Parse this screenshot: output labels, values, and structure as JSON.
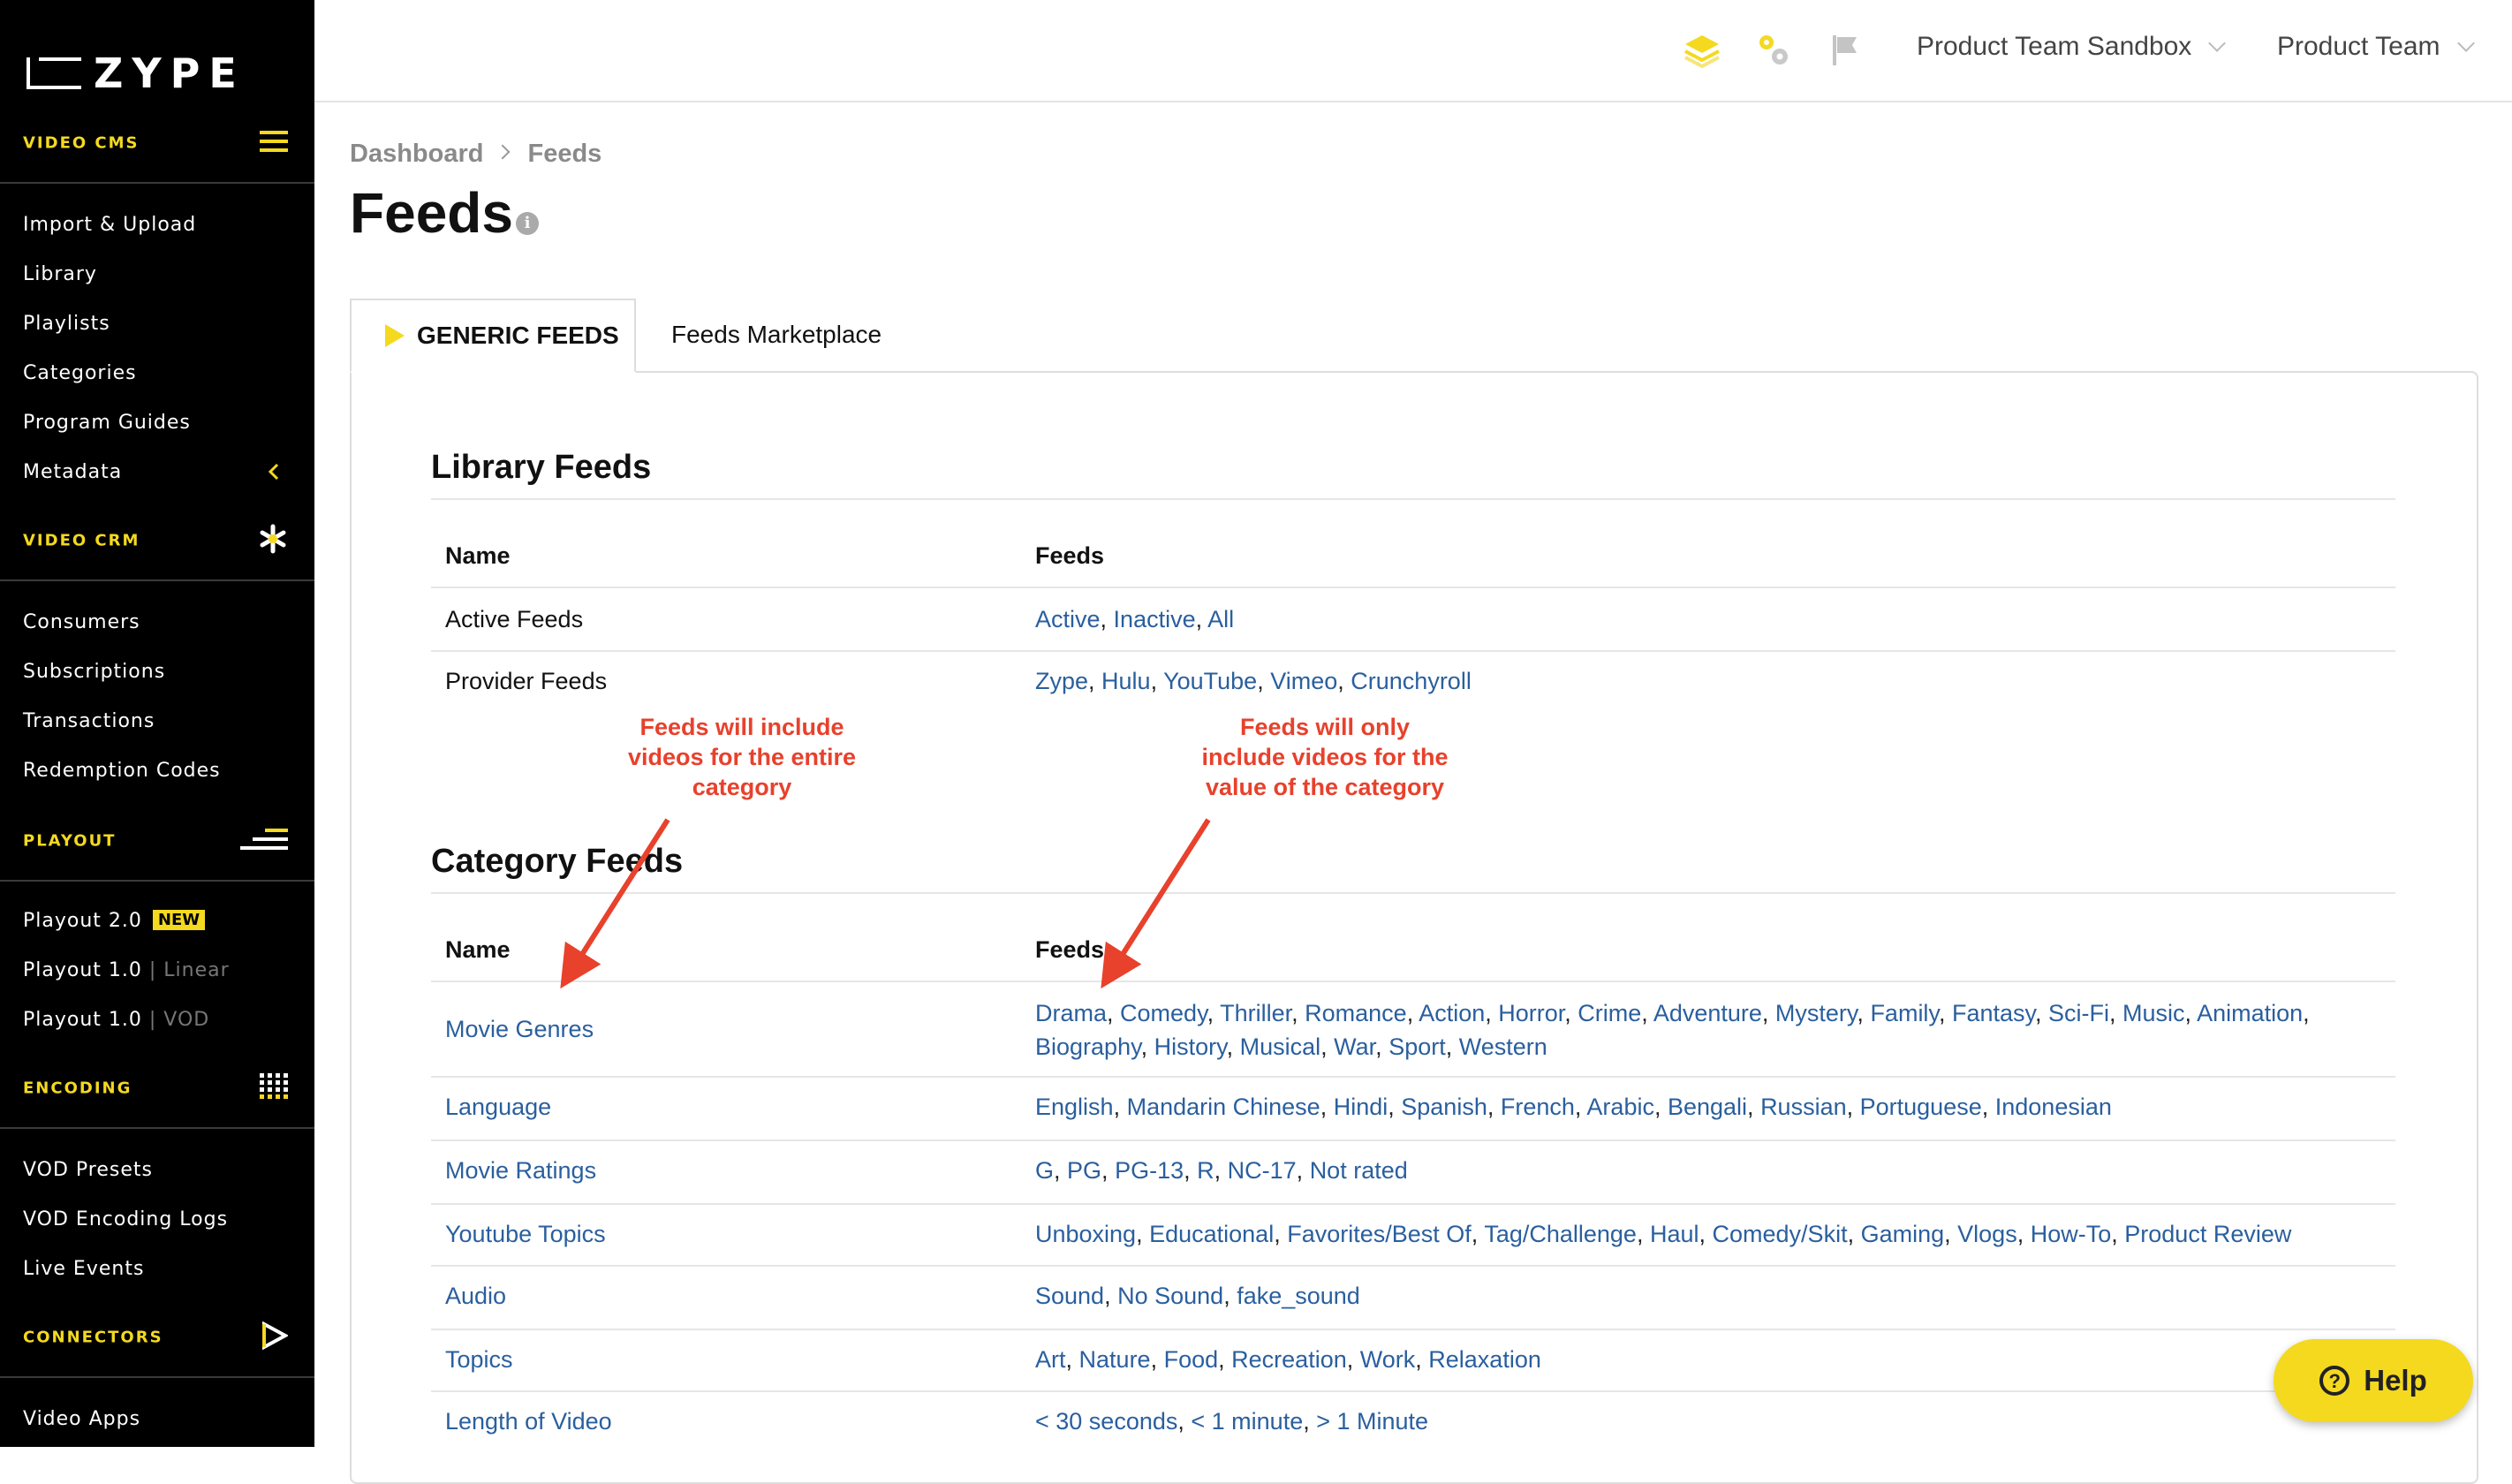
{
  "sidebar": {
    "logo": "ZYPE",
    "sections": [
      {
        "label": "VIDEO CMS",
        "icon": "hamburger-icon",
        "items": [
          "Import & Upload",
          "Library",
          "Playlists",
          "Categories",
          "Program Guides",
          "Metadata"
        ]
      },
      {
        "label": "VIDEO CRM",
        "icon": "asterisk-icon",
        "items": [
          "Consumers",
          "Subscriptions",
          "Transactions",
          "Redemption Codes"
        ]
      },
      {
        "label": "PLAYOUT",
        "icon": "stairs-icon",
        "items": [
          {
            "label": "Playout 2.0",
            "badge": "NEW"
          },
          {
            "label": "Playout 1.0",
            "sub": "Linear"
          },
          {
            "label": "Playout 1.0",
            "sub": "VOD"
          }
        ]
      },
      {
        "label": "ENCODING",
        "icon": "grid-dots-icon",
        "items": [
          "VOD Presets",
          "VOD Encoding Logs",
          "Live Events"
        ]
      },
      {
        "label": "CONNECTORS",
        "icon": "play-icon",
        "items": [
          "Video Apps"
        ]
      }
    ]
  },
  "topbar": {
    "icons": [
      "layers-icon",
      "gears-icon",
      "flag-icon"
    ],
    "workspace": "Product Team Sandbox",
    "account": "Product Team"
  },
  "breadcrumb": {
    "home": "Dashboard",
    "separator": ">",
    "current": "Feeds"
  },
  "page": {
    "title": "Feeds",
    "info": "i"
  },
  "tabs": {
    "active": "GENERIC FEEDS",
    "inactive": "Feeds Marketplace"
  },
  "library_feeds": {
    "title": "Library Feeds",
    "headers": {
      "name": "Name",
      "feeds": "Feeds"
    },
    "rows": [
      {
        "name": "Active Feeds",
        "feeds": [
          "Active",
          "Inactive",
          "All"
        ]
      },
      {
        "name": "Provider Feeds",
        "feeds": [
          "Zype",
          "Hulu",
          "YouTube",
          "Vimeo",
          "Crunchyroll"
        ]
      }
    ]
  },
  "category_feeds": {
    "title": "Category Feeds",
    "headers": {
      "name": "Name",
      "feeds": "Feeds"
    },
    "rows": [
      {
        "name": "Movie Genres",
        "feeds": [
          "Drama",
          "Comedy",
          "Thriller",
          "Romance",
          "Action",
          "Horror",
          "Crime",
          "Adventure",
          "Mystery",
          "Family",
          "Fantasy",
          "Sci-Fi",
          "Music",
          "Animation",
          "Biography",
          "History",
          "Musical",
          "War",
          "Sport",
          "Western"
        ]
      },
      {
        "name": "Language",
        "feeds": [
          "English",
          "Mandarin Chinese",
          "Hindi",
          "Spanish",
          "French",
          "Arabic",
          "Bengali",
          "Russian",
          "Portuguese",
          "Indonesian"
        ]
      },
      {
        "name": "Movie Ratings",
        "feeds": [
          "G",
          "PG",
          "PG-13",
          "R",
          "NC-17",
          "Not rated"
        ]
      },
      {
        "name": "Youtube Topics",
        "feeds": [
          "Unboxing",
          "Educational",
          "Favorites/Best Of",
          "Tag/Challenge",
          "Haul",
          "Comedy/Skit",
          "Gaming",
          "Vlogs",
          "How-To",
          "Product Review"
        ]
      },
      {
        "name": "Audio",
        "feeds": [
          "Sound",
          "No Sound",
          "fake_sound"
        ]
      },
      {
        "name": "Topics",
        "feeds": [
          "Art",
          "Nature",
          "Food",
          "Recreation",
          "Work",
          "Relaxation"
        ]
      },
      {
        "name": "Length of Video",
        "feeds": [
          "< 30 seconds",
          "< 1 minute",
          "> 1 Minute"
        ]
      }
    ]
  },
  "annotations": {
    "left": "Feeds will include videos for the entire category",
    "right": "Feeds will only include videos for the value of the category"
  },
  "help": {
    "label": "Help"
  },
  "colors": {
    "accent": "#f4d91f",
    "link": "#2a5f9e",
    "annotation": "#e8412c",
    "sidebar_bg": "#000000"
  }
}
